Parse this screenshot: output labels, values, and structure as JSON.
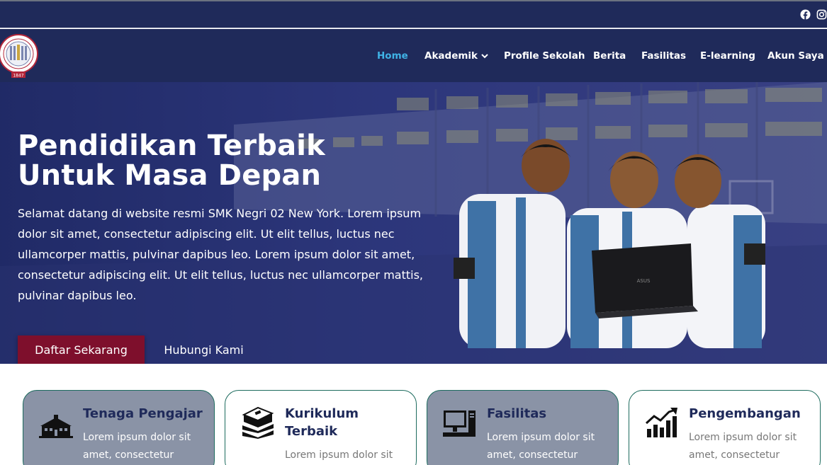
{
  "social": {
    "icons": [
      "facebook-icon",
      "instagram-icon"
    ]
  },
  "logo": {
    "icon": "school-seal-logo",
    "text": "1847"
  },
  "nav": {
    "items": [
      {
        "label": "Home",
        "active": true
      },
      {
        "label": "Akademik",
        "has_dropdown": true
      },
      {
        "label": "Profile Sekolah"
      },
      {
        "label": "Berita"
      },
      {
        "label": "Fasilitas"
      },
      {
        "label": "E-learning"
      },
      {
        "label": "Akun Saya"
      }
    ]
  },
  "hero": {
    "title_line1": "Pendidikan Terbaik",
    "title_line2": "Untuk Masa Depan",
    "description": "Selamat datang di website resmi SMK Negri 02 New York. Lorem ipsum dolor sit amet, consectetur adipiscing elit. Ut elit tellus, luctus nec ullamcorper mattis, pulvinar dapibus leo. Lorem ipsum dolor sit amet, consectetur adipiscing elit. Ut elit tellus, luctus nec ullamcorper mattis, pulvinar dapibus leo.",
    "primary_button": "Daftar Sekarang",
    "secondary_button": "Hubungi Kami"
  },
  "cards": [
    {
      "title": "Tenaga Pengajar",
      "text_line1": "Lorem ipsum dolor sit",
      "text_line2": "amet, consectetur",
      "icon": "school-building-icon"
    },
    {
      "title": "Kurikulum Terbaik",
      "text_line1": "Lorem ipsum dolor sit",
      "icon": "books-icon"
    },
    {
      "title": "Fasilitas",
      "text_line1": "Lorem ipsum dolor sit",
      "text_line2": "amet, consectetur",
      "icon": "computer-icon"
    },
    {
      "title": "Pengembangan",
      "text_line1": "Lorem ipsum dolor sit",
      "text_line2": "amet, consectetur",
      "icon": "growth-chart-icon"
    }
  ],
  "colors": {
    "navy": "#1f2a5a",
    "accent_blue": "#3fb3e6",
    "maroon": "#7e0f2c",
    "card_grey": "#8a93a6",
    "card_border": "#1d6b5e"
  }
}
